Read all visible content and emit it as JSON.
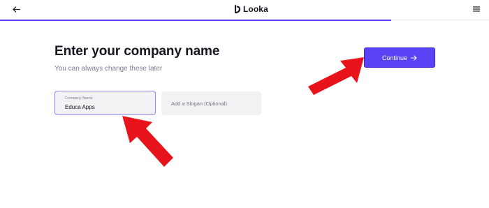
{
  "header": {
    "brand": "Looka",
    "progress_fraction": 0.8
  },
  "main": {
    "title": "Enter your company name",
    "subtitle": "You can always change these later",
    "company_field": {
      "label": "Company Name",
      "value": "Educa Apps"
    },
    "slogan_field": {
      "placeholder": "Add a Slogan (Optional)"
    },
    "continue_label": "Continue"
  },
  "colors": {
    "accent": "#5a43f5",
    "annotation": "#e8141c"
  },
  "icons": [
    "back-arrow-icon",
    "looka-logo-icon",
    "hamburger-menu-icon",
    "arrow-right-icon"
  ]
}
